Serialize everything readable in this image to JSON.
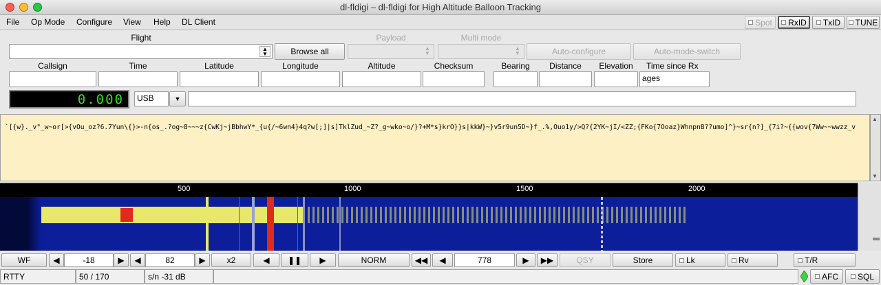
{
  "window": {
    "title": "dl-fldigi – dl-fldigi for High Altitude Balloon Tracking"
  },
  "menu": {
    "file": "File",
    "op_mode": "Op Mode",
    "configure": "Configure",
    "view": "View",
    "help": "Help",
    "dl_client": "DL Client"
  },
  "top_buttons": {
    "spot": "Spot",
    "rxid": "RxID",
    "txid": "TxID",
    "tune": "TUNE"
  },
  "flight": {
    "flight_label": "Flight",
    "browse_all": "Browse all",
    "payload_label": "Payload",
    "multi_mode_label": "Multi mode",
    "auto_configure": "Auto-configure",
    "auto_mode_switch": "Auto-mode-switch"
  },
  "telemetry": {
    "callsign_label": "Callsign",
    "time_label": "Time",
    "latitude_label": "Latitude",
    "longitude_label": "Longitude",
    "altitude_label": "Altitude",
    "checksum_label": "Checksum",
    "bearing_label": "Bearing",
    "distance_label": "Distance",
    "elevation_label": "Elevation",
    "time_since_rx_label": "Time since Rx",
    "time_since_rx_value": "ages"
  },
  "rig": {
    "frequency": "0.000",
    "mode": "USB"
  },
  "rx_text": "`[{w}._v\"_w~or[>{vOu_oz?6.7Yun\\{}>-n{os_.?og~8~~~z{CwKj~jBbhwY*_{u{/~6wn4}4q?w[;]|s]TklZud_~Z?_g~wko~o/}?+M*s}krO}}s|kkW}~}v5r9un5D~}f_.%,Ouo1y/>Q?{2YK~jI/<ZZ;{FKo{7Ooaz}WhnpnB??umo]^}~sr{n?]_{7i?~{{wov{7Ww~~wwzz_v",
  "waterfall": {
    "ticks": [
      "500",
      "1000",
      "1500",
      "2000"
    ],
    "colors": {
      "background": "#0d1e9a",
      "signal": "#e8e86a",
      "marker": "#e83020"
    }
  },
  "controls": {
    "wf": "WF",
    "level": "-18",
    "range": "82",
    "zoom": "x2",
    "norm": "NORM",
    "freq": "778",
    "qsy": "QSY",
    "store": "Store",
    "lk": "Lk",
    "rv": "Rv",
    "tr": "T/R"
  },
  "status": {
    "mode": "RTTY",
    "shift": "50  / 170",
    "sn": "s/n -31 dB",
    "afc": "AFC",
    "sql": "SQL"
  }
}
